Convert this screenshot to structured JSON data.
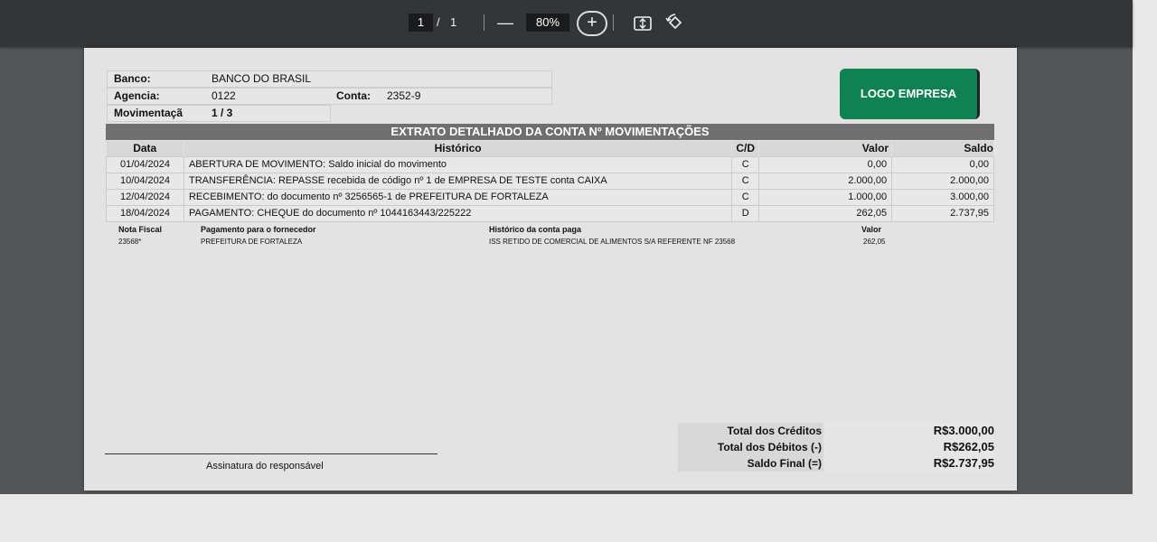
{
  "toolbar": {
    "page_current": "1",
    "page_separator": "/",
    "page_total": "1",
    "zoom_out_label": "—",
    "zoom_level": "80%",
    "zoom_in_label": "+"
  },
  "statement": {
    "bank_label": "Banco:",
    "bank_value": "BANCO DO BRASIL",
    "agency_label": "Agencia:",
    "agency_value": "0122",
    "account_label": "Conta:",
    "account_value": "2352-9",
    "movement_label": "Movimentaçã",
    "movement_value": "1 / 3",
    "logo_text": "LOGO EMPRESA",
    "title": "EXTRATO DETALHADO DA CONTA Nº MOVIMENTAÇÕES",
    "columns": {
      "date": "Data",
      "history": "Histórico",
      "cd": "C/D",
      "value": "Valor",
      "balance": "Saldo"
    },
    "rows": [
      {
        "date": "01/04/2024",
        "history": "ABERTURA DE MOVIMENTO: Saldo inicial do movimento",
        "cd": "C",
        "value": "0,00",
        "balance": "0,00"
      },
      {
        "date": "10/04/2024",
        "history": "TRANSFERÊNCIA: REPASSE recebida de código nº 1 de EMPRESA DE TESTE conta CAIXA",
        "cd": "C",
        "value": "2.000,00",
        "balance": "2.000,00"
      },
      {
        "date": "12/04/2024",
        "history": "RECEBIMENTO: do documento nº 3256565-1 de PREFEITURA DE FORTALEZA",
        "cd": "C",
        "value": "1.000,00",
        "balance": "3.000,00"
      },
      {
        "date": "18/04/2024",
        "history": "PAGAMENTO: CHEQUE do documento nº 1044163443/225222",
        "cd": "D",
        "value": "262,05",
        "balance": "2.737,95"
      }
    ],
    "detail": {
      "h_invoice": "Nota Fiscal",
      "h_supplier": "Pagamento para o fornecedor",
      "h_history": "Histórico da conta paga",
      "h_value": "Valor",
      "invoice": "23568*",
      "supplier": "PREFEITURA DE FORTALEZA",
      "history": "ISS RETIDO DE COMERCIAL DE ALIMENTOS S/A REFERENTE NF 23568",
      "value": "262,05"
    },
    "signature_label": "Assinatura do responsável",
    "totals": {
      "credits_label": "Total dos Créditos",
      "credits_value": "R$3.000,00",
      "debits_label": "Total dos Débitos (-)",
      "debits_value": "R$262,05",
      "final_label": "Saldo Final (=)",
      "final_value": "R$2.737,95"
    }
  }
}
